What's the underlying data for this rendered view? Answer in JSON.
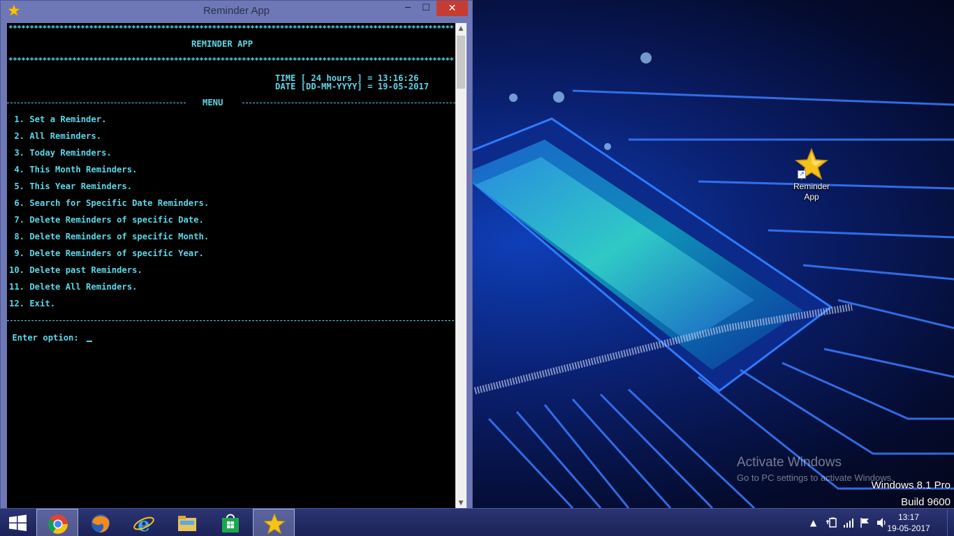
{
  "window": {
    "title": "Reminder App",
    "minimize": "─",
    "maximize": "☐",
    "close": "✕"
  },
  "console": {
    "stars": "*********************************************************************************************************",
    "app_title": "REMINDER APP",
    "time_line": "TIME [ 24 hours ] = 13:16:26",
    "date_line": "DATE [DD-MM-YYYY] = 19-05-2017",
    "menu_heading": "MENU",
    "menu": [
      " 1. Set a Reminder.",
      " 2. All Reminders.",
      " 3. Today Reminders.",
      " 4. This Month Reminders.",
      " 5. This Year Reminders.",
      " 6. Search for Specific Date Reminders.",
      " 7. Delete Reminders of specific Date.",
      " 8. Delete Reminders of specific Month.",
      " 9. Delete Reminders of specific Year.",
      "10. Delete past Reminders.",
      "11. Delete All Reminders.",
      "12. Exit."
    ],
    "prompt": " Enter option: "
  },
  "desktop": {
    "icon_label_line1": "Reminder",
    "icon_label_line2": "App",
    "icon": "star-icon"
  },
  "watermark": {
    "title": "Activate Windows",
    "subtitle": "Go to PC settings to activate Windows."
  },
  "os": {
    "edition": "Windows 8.1 Pro",
    "build": "Build 9600"
  },
  "taskbar": {
    "apps": [
      "chrome-icon",
      "firefox-icon",
      "internet-explorer-icon",
      "file-explorer-icon",
      "store-icon",
      "reminder-app-icon"
    ],
    "clock_time": "13:17",
    "clock_date": "19-05-2017",
    "tray_arrow": "▲"
  },
  "colors": {
    "console_text": "#5ad7e8",
    "console_bg": "#000000",
    "window_frame": "#6f78b6",
    "close_button": "#c73c32"
  }
}
